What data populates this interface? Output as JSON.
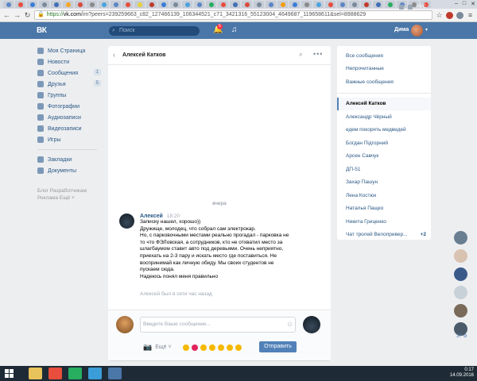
{
  "browser": {
    "url_secure": "https://",
    "url_host": "vk.com",
    "url_path": "/im?peers=239259663_c82_127466139_106344521_c71_3421316_55123004_4649687_119658611&sel=8988629",
    "tab_colors": [
      "#5b86c5",
      "#e84d3d",
      "#3b7dd8",
      "#7a8a9a",
      "#3f6fb5",
      "#f5a623",
      "#d94b3c",
      "#8a8a8a",
      "#4aa3df",
      "#5b86c5",
      "#e84d3d",
      "#e8d03d",
      "#c0392b",
      "#3b7dd8",
      "#7a8a9a",
      "#4aa3df",
      "#5b86c5",
      "#27ae60",
      "#e84d3d",
      "#3f6fb5",
      "#d94b3c",
      "#7a8a9a",
      "#5b86c5",
      "#f39c12",
      "#3b7dd8",
      "#8a8a8a",
      "#4aa3df",
      "#e84d3d",
      "#5b86c5",
      "#7a8a9a",
      "#c0392b",
      "#3f6fb5",
      "#27ae60",
      "#5b86c5",
      "#8a8a8a",
      "#e84d3d"
    ],
    "ext_colors": [
      "#c0392b",
      "#7a8a9a",
      "#9aa7b4"
    ]
  },
  "header": {
    "logo": "ВК",
    "search_placeholder": "Поиск",
    "notifications_count": "5",
    "user_name": "Дима"
  },
  "leftnav": {
    "items": [
      {
        "label": "Моя Страница",
        "badge": ""
      },
      {
        "label": "Новости",
        "badge": ""
      },
      {
        "label": "Сообщения",
        "badge": "1"
      },
      {
        "label": "Друзья",
        "badge": "5"
      },
      {
        "label": "Группы",
        "badge": ""
      },
      {
        "label": "Фотографии",
        "badge": ""
      },
      {
        "label": "Аудиозаписи",
        "badge": ""
      },
      {
        "label": "Видеозаписи",
        "badge": ""
      },
      {
        "label": "Игры",
        "badge": ""
      }
    ],
    "items2": [
      {
        "label": "Закладки"
      },
      {
        "label": "Документы"
      }
    ],
    "footer_line1": "Блог   Разработчикам",
    "footer_line2": "Реклама   Ещё ˅"
  },
  "chat": {
    "title": "Алексей Катков",
    "day_separator": "вчера",
    "message": {
      "author": "Алексей",
      "time": "18:20",
      "lines": [
        "Записку нашел, хорошо))",
        "Дружище, молодец, что собрал сам электрокар.",
        "Но, с парковочными местами реально прогадал - парковка не",
        "то что ФЭЛовская, а сотрудников, кто не отхватил место за",
        "шлагбаумом ставит авто под деревьями. Очень неприятно,",
        "приехать на 2-3 пару и искать место где поставиться. Не",
        "воспринимай как личную обиду. Мы своих студентов не",
        "пускаем сюда.",
        "Надеюсь понял меня правильно"
      ]
    },
    "last_seen": "Алексей был в сети час назад",
    "composer": {
      "placeholder": "Введите Ваше сообщение...",
      "more_label": "Ещё ˅",
      "send_label": "Отправить",
      "emoji_colors": [
        "#f5b800",
        "#e0245e",
        "#f5b800",
        "#f5b800",
        "#f5b800",
        "#f5b800",
        "#f5b800"
      ]
    }
  },
  "rightlist": {
    "filters": [
      "Все сообщения",
      "Непрочитанные",
      "Важные сообщения"
    ],
    "conversations": [
      {
        "name": "Алексей Катков",
        "active": true,
        "count": ""
      },
      {
        "name": "Александр Чёрный",
        "active": false,
        "count": ""
      },
      {
        "name": "едем покорять медведей",
        "active": false,
        "count": ""
      },
      {
        "name": "Богдан Підгорний",
        "active": false,
        "count": ""
      },
      {
        "name": "Арсен Савчук",
        "active": false,
        "count": ""
      },
      {
        "name": "ДП-51",
        "active": false,
        "count": ""
      },
      {
        "name": "Захар Пашун",
        "active": false,
        "count": ""
      },
      {
        "name": "Лена Костюк",
        "active": false,
        "count": ""
      },
      {
        "name": "Наталья Пащко",
        "active": false,
        "count": ""
      },
      {
        "name": "Никита Гриценко",
        "active": false,
        "count": ""
      },
      {
        "name": "Чат тролей Велопривер...",
        "active": false,
        "count": "+2"
      }
    ]
  },
  "side_avatars": {
    "colors": [
      "#6a7e92",
      "#d8c2b0",
      "#3a5a8a",
      "#c8d0d8",
      "#7a6a5a",
      "#4a5a6a"
    ],
    "count_label": "37 ⚙"
  },
  "taskbar": {
    "icons": [
      "#e8c25a",
      "#e84d3d",
      "#27ae60",
      "#3b9dd8",
      "#4a76a8"
    ],
    "lang": "РУС",
    "time": "0:17",
    "date": "14.09.2016"
  }
}
